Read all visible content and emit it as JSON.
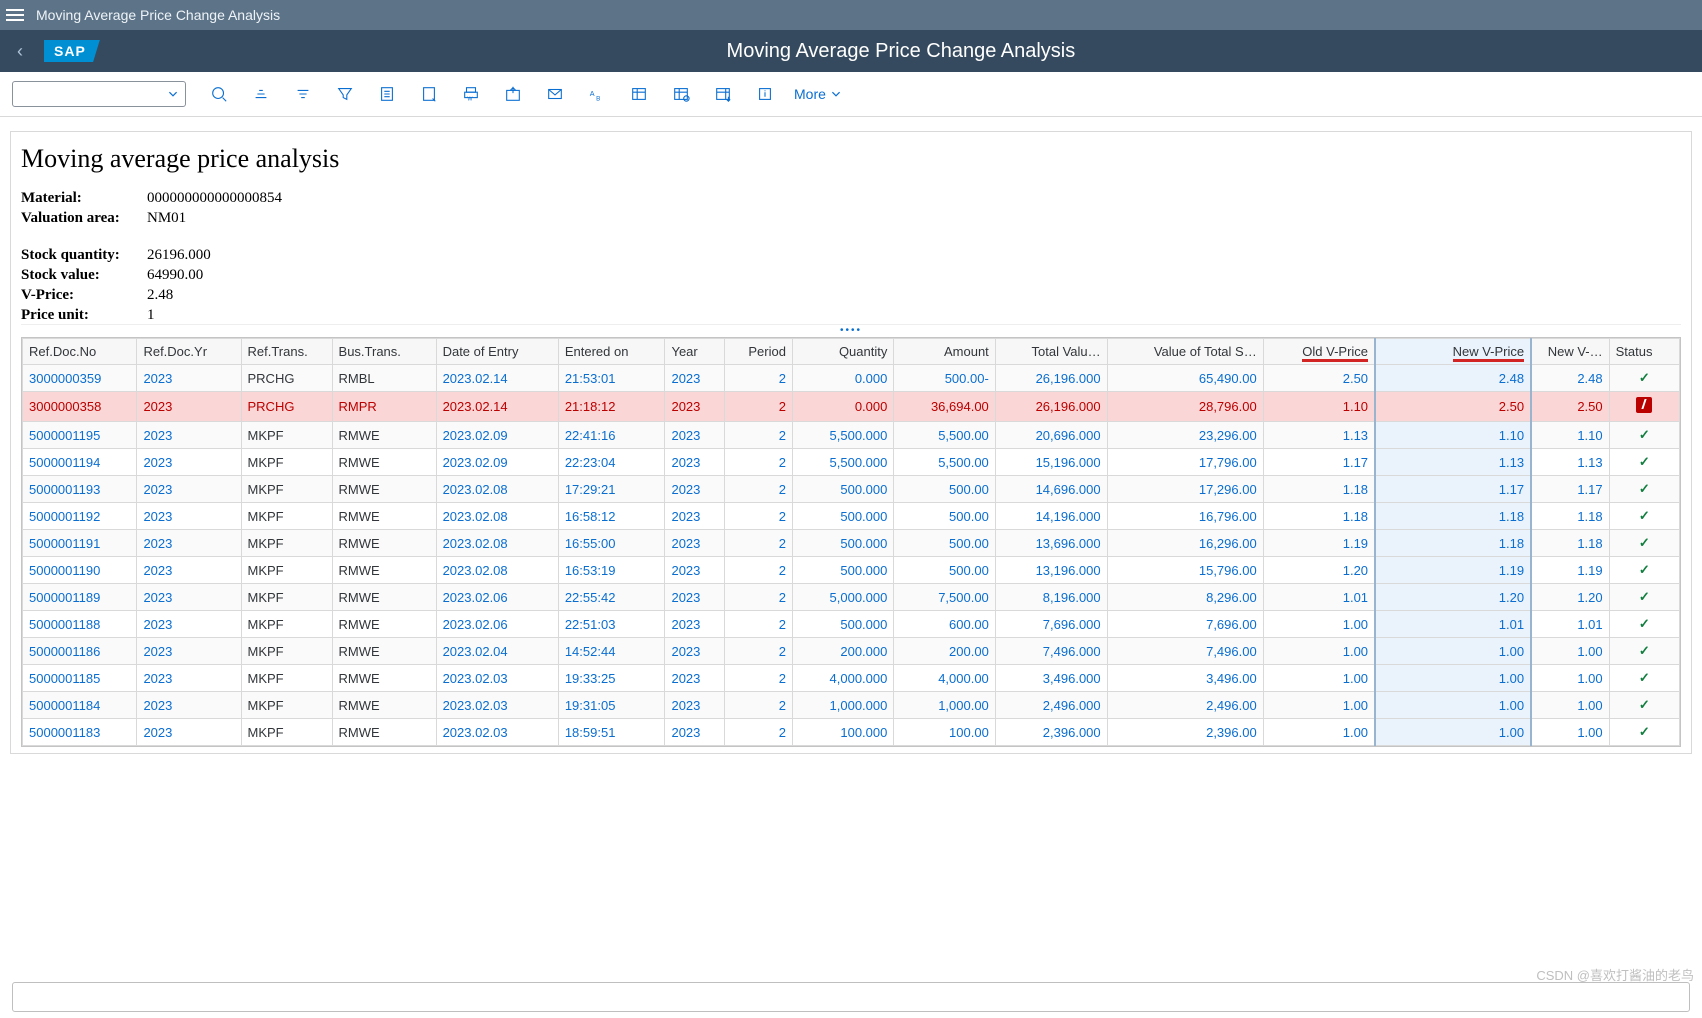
{
  "topbar": {
    "title": "Moving Average Price Change Analysis"
  },
  "header": {
    "page_title": "Moving Average Price Change Analysis",
    "logo": "SAP"
  },
  "toolbar": {
    "more_label": "More"
  },
  "panel": {
    "heading": "Moving average price analysis",
    "labels": {
      "material": "Material:",
      "valarea": "Valuation area:",
      "stockqty": "Stock quantity:",
      "stockval": "Stock value:",
      "vprice": "V-Price:",
      "punit": "Price unit:"
    },
    "values": {
      "material": "000000000000000854",
      "valarea": "NM01",
      "stockqty": "26196.000",
      "stockval": "64990.00",
      "vprice": "2.48",
      "punit": "1"
    }
  },
  "columns": {
    "refdocno": "Ref.Doc.No",
    "refdocyr": "Ref.Doc.Yr",
    "reftrans": "Ref.Trans.",
    "bustrans": "Bus.Trans.",
    "date": "Date of Entry",
    "entered": "Entered on",
    "year": "Year",
    "period": "Period",
    "qty": "Quantity",
    "amount": "Amount",
    "totalval": "Total Valu…",
    "valuetotal": "Value of Total S…",
    "oldp": "Old V-Price",
    "newp": "New V-Price",
    "newv": "New V-…",
    "status": "Status"
  },
  "rows": [
    {
      "ref": "3000000359",
      "yr": "2023",
      "rt": "PRCHG",
      "bt": "RMBL",
      "date": "2023.02.14",
      "time": "21:53:01",
      "y": "2023",
      "p": "2",
      "qty": "0.000",
      "amt": "500.00-",
      "tv": "26,196.000",
      "vts": "65,490.00",
      "op": "2.50",
      "np": "2.48",
      "nv": "2.48",
      "st": "ok",
      "hl": false
    },
    {
      "ref": "3000000358",
      "yr": "2023",
      "rt": "PRCHG",
      "bt": "RMPR",
      "date": "2023.02.14",
      "time": "21:18:12",
      "y": "2023",
      "p": "2",
      "qty": "0.000",
      "amt": "36,694.00",
      "tv": "26,196.000",
      "vts": "28,796.00",
      "op": "1.10",
      "np": "2.50",
      "nv": "2.50",
      "st": "warn",
      "hl": true
    },
    {
      "ref": "5000001195",
      "yr": "2023",
      "rt": "MKPF",
      "bt": "RMWE",
      "date": "2023.02.09",
      "time": "22:41:16",
      "y": "2023",
      "p": "2",
      "qty": "5,500.000",
      "amt": "5,500.00",
      "tv": "20,696.000",
      "vts": "23,296.00",
      "op": "1.13",
      "np": "1.10",
      "nv": "1.10",
      "st": "ok",
      "hl": false
    },
    {
      "ref": "5000001194",
      "yr": "2023",
      "rt": "MKPF",
      "bt": "RMWE",
      "date": "2023.02.09",
      "time": "22:23:04",
      "y": "2023",
      "p": "2",
      "qty": "5,500.000",
      "amt": "5,500.00",
      "tv": "15,196.000",
      "vts": "17,796.00",
      "op": "1.17",
      "np": "1.13",
      "nv": "1.13",
      "st": "ok",
      "hl": false
    },
    {
      "ref": "5000001193",
      "yr": "2023",
      "rt": "MKPF",
      "bt": "RMWE",
      "date": "2023.02.08",
      "time": "17:29:21",
      "y": "2023",
      "p": "2",
      "qty": "500.000",
      "amt": "500.00",
      "tv": "14,696.000",
      "vts": "17,296.00",
      "op": "1.18",
      "np": "1.17",
      "nv": "1.17",
      "st": "ok",
      "hl": false
    },
    {
      "ref": "5000001192",
      "yr": "2023",
      "rt": "MKPF",
      "bt": "RMWE",
      "date": "2023.02.08",
      "time": "16:58:12",
      "y": "2023",
      "p": "2",
      "qty": "500.000",
      "amt": "500.00",
      "tv": "14,196.000",
      "vts": "16,796.00",
      "op": "1.18",
      "np": "1.18",
      "nv": "1.18",
      "st": "ok",
      "hl": false
    },
    {
      "ref": "5000001191",
      "yr": "2023",
      "rt": "MKPF",
      "bt": "RMWE",
      "date": "2023.02.08",
      "time": "16:55:00",
      "y": "2023",
      "p": "2",
      "qty": "500.000",
      "amt": "500.00",
      "tv": "13,696.000",
      "vts": "16,296.00",
      "op": "1.19",
      "np": "1.18",
      "nv": "1.18",
      "st": "ok",
      "hl": false
    },
    {
      "ref": "5000001190",
      "yr": "2023",
      "rt": "MKPF",
      "bt": "RMWE",
      "date": "2023.02.08",
      "time": "16:53:19",
      "y": "2023",
      "p": "2",
      "qty": "500.000",
      "amt": "500.00",
      "tv": "13,196.000",
      "vts": "15,796.00",
      "op": "1.20",
      "np": "1.19",
      "nv": "1.19",
      "st": "ok",
      "hl": false
    },
    {
      "ref": "5000001189",
      "yr": "2023",
      "rt": "MKPF",
      "bt": "RMWE",
      "date": "2023.02.06",
      "time": "22:55:42",
      "y": "2023",
      "p": "2",
      "qty": "5,000.000",
      "amt": "7,500.00",
      "tv": "8,196.000",
      "vts": "8,296.00",
      "op": "1.01",
      "np": "1.20",
      "nv": "1.20",
      "st": "ok",
      "hl": false
    },
    {
      "ref": "5000001188",
      "yr": "2023",
      "rt": "MKPF",
      "bt": "RMWE",
      "date": "2023.02.06",
      "time": "22:51:03",
      "y": "2023",
      "p": "2",
      "qty": "500.000",
      "amt": "600.00",
      "tv": "7,696.000",
      "vts": "7,696.00",
      "op": "1.00",
      "np": "1.01",
      "nv": "1.01",
      "st": "ok",
      "hl": false
    },
    {
      "ref": "5000001186",
      "yr": "2023",
      "rt": "MKPF",
      "bt": "RMWE",
      "date": "2023.02.04",
      "time": "14:52:44",
      "y": "2023",
      "p": "2",
      "qty": "200.000",
      "amt": "200.00",
      "tv": "7,496.000",
      "vts": "7,496.00",
      "op": "1.00",
      "np": "1.00",
      "nv": "1.00",
      "st": "ok",
      "hl": false
    },
    {
      "ref": "5000001185",
      "yr": "2023",
      "rt": "MKPF",
      "bt": "RMWE",
      "date": "2023.02.03",
      "time": "19:33:25",
      "y": "2023",
      "p": "2",
      "qty": "4,000.000",
      "amt": "4,000.00",
      "tv": "3,496.000",
      "vts": "3,496.00",
      "op": "1.00",
      "np": "1.00",
      "nv": "1.00",
      "st": "ok",
      "hl": false
    },
    {
      "ref": "5000001184",
      "yr": "2023",
      "rt": "MKPF",
      "bt": "RMWE",
      "date": "2023.02.03",
      "time": "19:31:05",
      "y": "2023",
      "p": "2",
      "qty": "1,000.000",
      "amt": "1,000.00",
      "tv": "2,496.000",
      "vts": "2,496.00",
      "op": "1.00",
      "np": "1.00",
      "nv": "1.00",
      "st": "ok",
      "hl": false
    },
    {
      "ref": "5000001183",
      "yr": "2023",
      "rt": "MKPF",
      "bt": "RMWE",
      "date": "2023.02.03",
      "time": "18:59:51",
      "y": "2023",
      "p": "2",
      "qty": "100.000",
      "amt": "100.00",
      "tv": "2,396.000",
      "vts": "2,396.00",
      "op": "1.00",
      "np": "1.00",
      "nv": "1.00",
      "st": "ok",
      "hl": false
    }
  ],
  "watermark": "CSDN @喜欢打酱油的老鸟"
}
